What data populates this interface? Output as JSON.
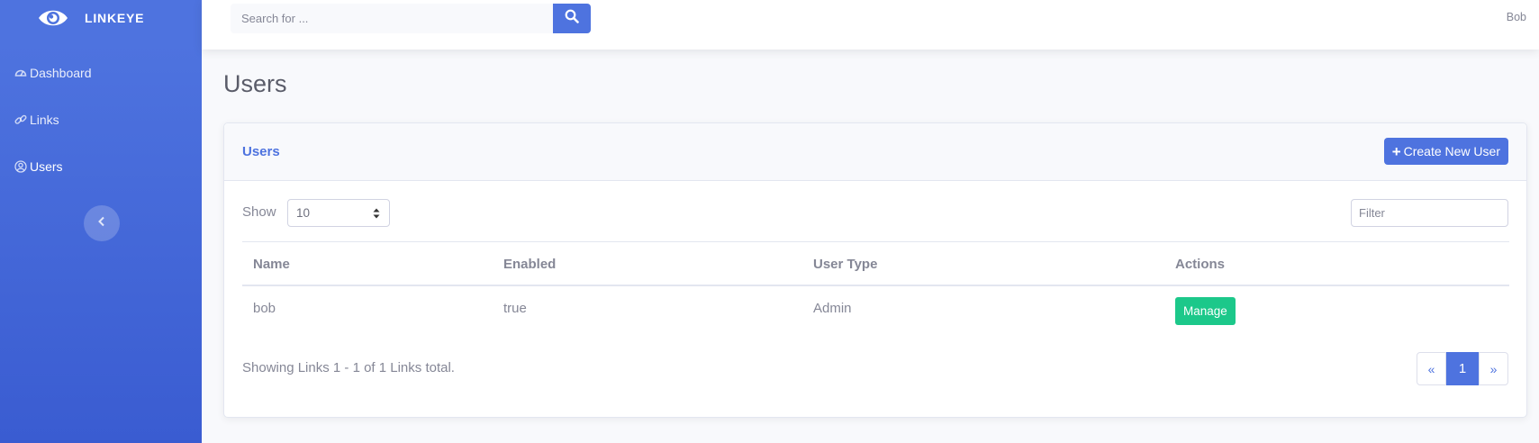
{
  "app": {
    "brand": "LINKEYE"
  },
  "sidebar": {
    "items": [
      {
        "label": "Dashboard",
        "icon": "dashboard-icon"
      },
      {
        "label": "Links",
        "icon": "link-icon"
      },
      {
        "label": "Users",
        "icon": "user-circle-icon"
      }
    ],
    "collapse_icon": "chevron-left-icon"
  },
  "topbar": {
    "search_placeholder": "Search for ...",
    "search_icon": "search-icon",
    "user": "Bob"
  },
  "page": {
    "title": "Users"
  },
  "card": {
    "title": "Users",
    "create_button": "Create New User",
    "show_label": "Show",
    "show_value": "10",
    "filter_placeholder": "Filter",
    "table": {
      "headers": [
        "Name",
        "Enabled",
        "User Type",
        "Actions"
      ],
      "rows": [
        {
          "name": "bob",
          "enabled": "true",
          "user_type": "Admin",
          "action": "Manage"
        }
      ]
    },
    "summary": "Showing Links 1 - 1 of 1 Links total.",
    "pagination": {
      "prev": "«",
      "current": "1",
      "next": "»"
    }
  },
  "colors": {
    "primary": "#4e73df",
    "success": "#1cc88a",
    "text_muted": "#858796",
    "background": "#f8f9fc"
  }
}
